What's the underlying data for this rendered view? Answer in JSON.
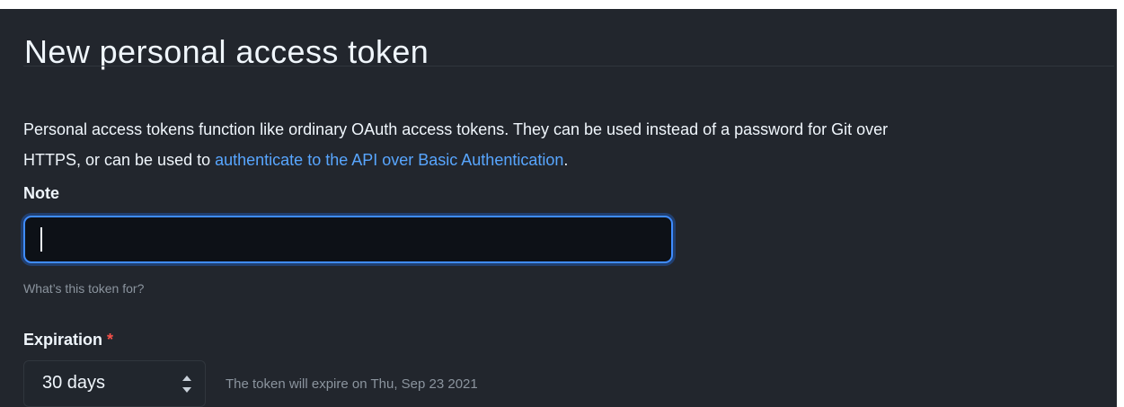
{
  "page": {
    "title": "New personal access token"
  },
  "description": {
    "text_before_link": "Personal access tokens function like ordinary OAuth access tokens. They can be used instead of a password for Git over",
    "text_before_link_line2": "HTTPS, or can be used to ",
    "link_text": "authenticate to the API over Basic Authentication",
    "text_after_link": "."
  },
  "form": {
    "note": {
      "label": "Note",
      "value": "",
      "help_text": "What’s this token for?"
    },
    "expiration": {
      "label": "Expiration",
      "required_marker": "*",
      "selected_value": "30 days",
      "note": "The token will expire on Thu, Sep 23 2021"
    }
  },
  "colors": {
    "background": "#22262d",
    "text": "#f0f6fc",
    "muted_text": "#8b949e",
    "link": "#58a6ff",
    "focus_border": "#3f8cff",
    "required": "#f85149"
  },
  "icons": {
    "select_arrow": "up-down-chevron-icon"
  }
}
